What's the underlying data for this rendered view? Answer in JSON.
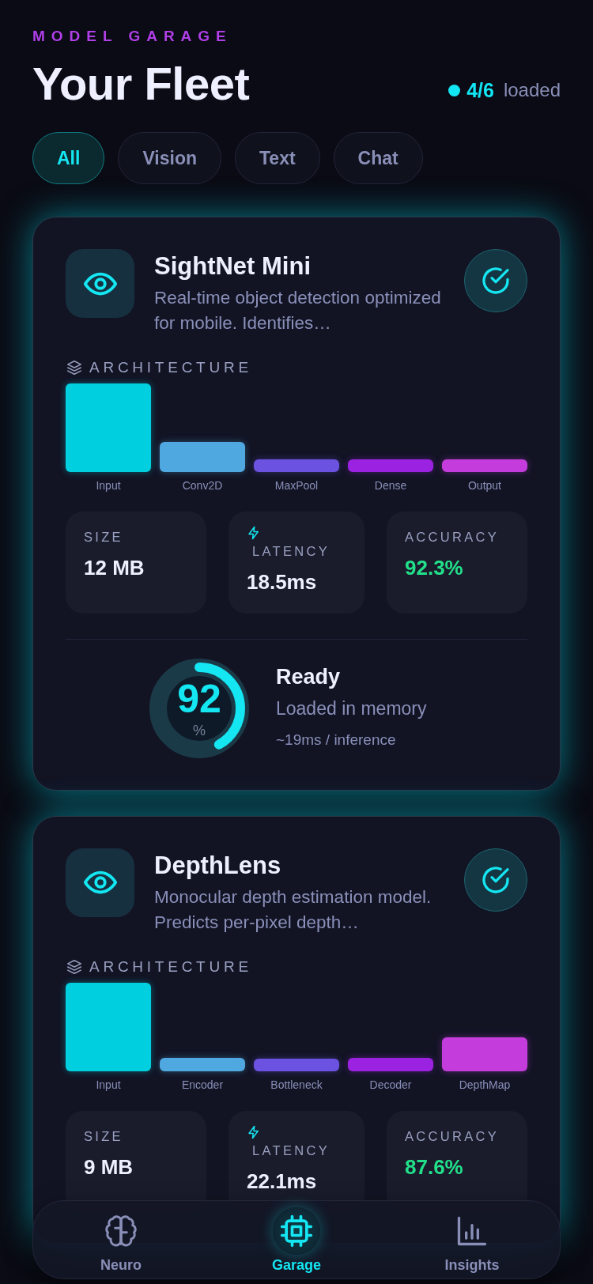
{
  "header": {
    "eyebrow": "MODEL GARAGE",
    "title": "Your Fleet",
    "loaded_count": "4/6",
    "loaded_label": "loaded"
  },
  "tabs": [
    {
      "label": "All",
      "selected": true
    },
    {
      "label": "Vision",
      "selected": false
    },
    {
      "label": "Text",
      "selected": false
    },
    {
      "label": "Chat",
      "selected": false
    }
  ],
  "cards": [
    {
      "name": "SightNet Mini",
      "description": "Real-time object detection optimized for mobile. Identifies…",
      "loaded": true,
      "architecture_label": "ARCHITECTURE",
      "layers": [
        {
          "label": "Input",
          "color": "#00cfe0"
        },
        {
          "label": "Conv2D",
          "color": "#4fa8e0"
        },
        {
          "label": "MaxPool",
          "color": "#6b52e0"
        },
        {
          "label": "Dense",
          "color": "#9b22e0"
        },
        {
          "label": "Output",
          "color": "#c43ddc"
        }
      ],
      "stats": [
        {
          "kind": "size",
          "label": "SIZE",
          "value": "12 MB"
        },
        {
          "kind": "latency",
          "label": "LATENCY",
          "value": "18.5ms"
        },
        {
          "kind": "accuracy",
          "label": "ACCURACY",
          "value": "92.3%"
        }
      ],
      "status": {
        "number": "92",
        "unit": "%",
        "level": 0.42,
        "title": "Ready",
        "subtitle": "Loaded in memory",
        "detail": "~19ms / inference"
      }
    },
    {
      "name": "DepthLens",
      "description": "Monocular depth estimation model. Predicts per-pixel depth…",
      "loaded": true,
      "architecture_label": "ARCHITECTURE",
      "layers": [
        {
          "label": "Input",
          "color": "#00cfe0"
        },
        {
          "label": "Encoder",
          "color": "#4fa8e0"
        },
        {
          "label": "Bottleneck",
          "color": "#6b52e0"
        },
        {
          "label": "Decoder",
          "color": "#9b22e0"
        },
        {
          "label": "DepthMap",
          "color": "#c43ddc"
        }
      ],
      "stats": [
        {
          "kind": "size",
          "label": "SIZE",
          "value": "9 MB"
        },
        {
          "kind": "latency",
          "label": "LATENCY",
          "value": "22.1ms"
        },
        {
          "kind": "accuracy",
          "label": "ACCURACY",
          "value": "87.6%"
        }
      ]
    }
  ],
  "bottom_nav": [
    {
      "kind": "brain",
      "label": "Neuro",
      "selected": false
    },
    {
      "kind": "chip",
      "label": "Garage",
      "selected": true
    },
    {
      "kind": "chart",
      "label": "Insights",
      "selected": false
    }
  ]
}
